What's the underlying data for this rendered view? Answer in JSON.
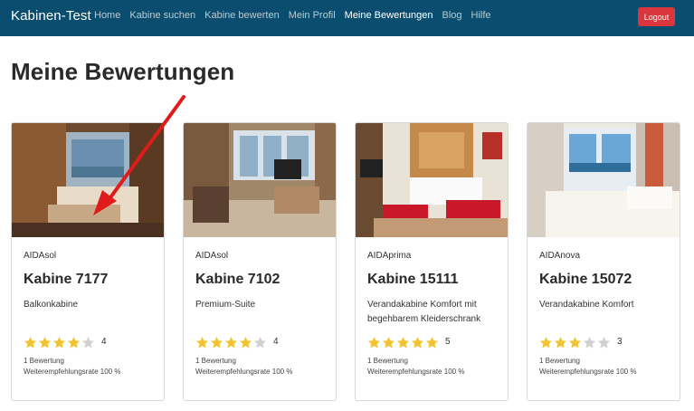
{
  "nav": {
    "brand": "Kabinen-Test",
    "links": [
      {
        "label": "Home",
        "active": false
      },
      {
        "label": "Kabine suchen",
        "active": false
      },
      {
        "label": "Kabine bewerten",
        "active": false
      },
      {
        "label": "Mein Profil",
        "active": false
      },
      {
        "label": "Meine Bewertungen",
        "active": true
      },
      {
        "label": "Blog",
        "active": false
      },
      {
        "label": "Hilfe",
        "active": false
      }
    ],
    "logout_label": "Logout"
  },
  "page": {
    "title": "Meine Bewertungen"
  },
  "cards": [
    {
      "ship": "AIDAsol",
      "cabin": "Kabine 7177",
      "type": "Balkonkabine",
      "stars": 4,
      "rating": "4",
      "count": "1 Bewertung",
      "recommend": "Weiterempfehlungsrate 100 %"
    },
    {
      "ship": "AIDAsol",
      "cabin": "Kabine 7102",
      "type": "Premium-Suite",
      "stars": 4,
      "rating": "4",
      "count": "1 Bewertung",
      "recommend": "Weiterempfehlungsrate 100 %"
    },
    {
      "ship": "AIDAprima",
      "cabin": "Kabine 15111",
      "type": "Verandakabine Komfort mit begehbarem Kleiderschrank",
      "stars": 5,
      "rating": "5",
      "count": "1 Bewertung",
      "recommend": "Weiterempfehlungsrate 100 %"
    },
    {
      "ship": "AIDAnova",
      "cabin": "Kabine 15072",
      "type": "Verandakabine Komfort",
      "stars": 3,
      "rating": "3",
      "count": "1 Bewertung",
      "recommend": "Weiterempfehlungsrate 100 %"
    }
  ],
  "colors": {
    "navbar": "#0b4d6e",
    "logout": "#d9363e",
    "star_on": "#f2c233",
    "star_off": "#d0d0d0",
    "annotation_arrow": "#e01b1b"
  }
}
